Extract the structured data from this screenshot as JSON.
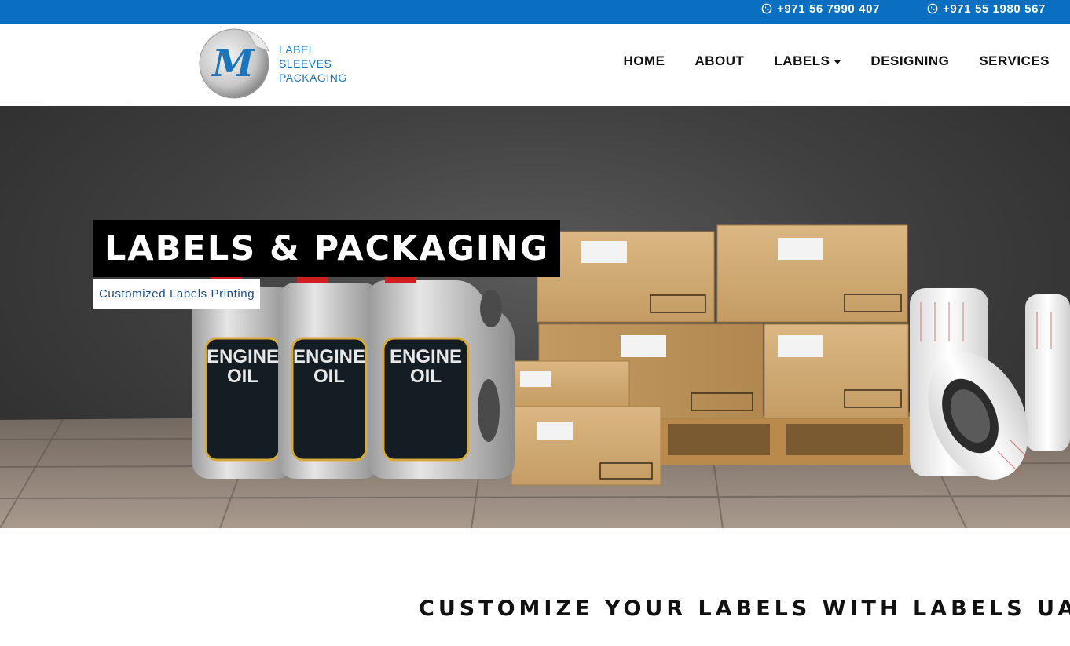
{
  "topbar": {
    "phones": [
      "+971 56 7990 407",
      "+971 55 1980 567"
    ],
    "icon": "whatsapp-icon",
    "color": "#0a6fc0"
  },
  "logo": {
    "lines": [
      "LABEL",
      "SLEEVES",
      "PACKAGING"
    ],
    "mark": "M"
  },
  "nav": {
    "items": [
      "HOME",
      "ABOUT",
      "LABELS",
      "DESIGNING",
      "SERVICES"
    ]
  },
  "hero": {
    "title": "LABELS & PACKAGING",
    "subtitle": "Customized Labels Printing",
    "product_label_line1": "ENGINE",
    "product_label_line2": "OIL"
  },
  "section": {
    "title": "CUSTOMIZE YOUR LABELS WITH LABELS UAE"
  }
}
